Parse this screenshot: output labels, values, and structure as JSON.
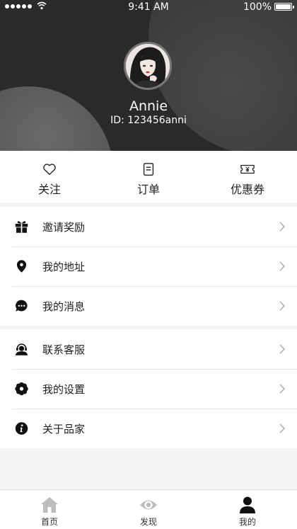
{
  "status": {
    "time": "9:41 AM",
    "battery": "100%"
  },
  "profile": {
    "name": "Annie",
    "id_text": "ID: 123456anni"
  },
  "quick": [
    {
      "label": "关注",
      "icon": "heart-icon"
    },
    {
      "label": "订单",
      "icon": "order-list-icon"
    },
    {
      "label": "优惠券",
      "icon": "coupon-icon"
    }
  ],
  "menu1": [
    {
      "label": "邀请奖励",
      "icon": "gift-icon"
    },
    {
      "label": "我的地址",
      "icon": "location-pin-icon"
    },
    {
      "label": "我的消息",
      "icon": "chat-bubble-icon"
    }
  ],
  "menu2": [
    {
      "label": "联系客服",
      "icon": "customer-service-icon"
    },
    {
      "label": "我的设置",
      "icon": "settings-gear-icon"
    },
    {
      "label": "关于品家",
      "icon": "info-icon"
    }
  ],
  "tabs": [
    {
      "label": "首页",
      "icon": "home-icon",
      "active": false
    },
    {
      "label": "发现",
      "icon": "eye-icon",
      "active": false
    },
    {
      "label": "我的",
      "icon": "person-icon",
      "active": true
    }
  ],
  "colors": {
    "header_bg": "#2a2a2a",
    "inactive_tab": "#bdbdbd",
    "active_tab": "#111111"
  }
}
